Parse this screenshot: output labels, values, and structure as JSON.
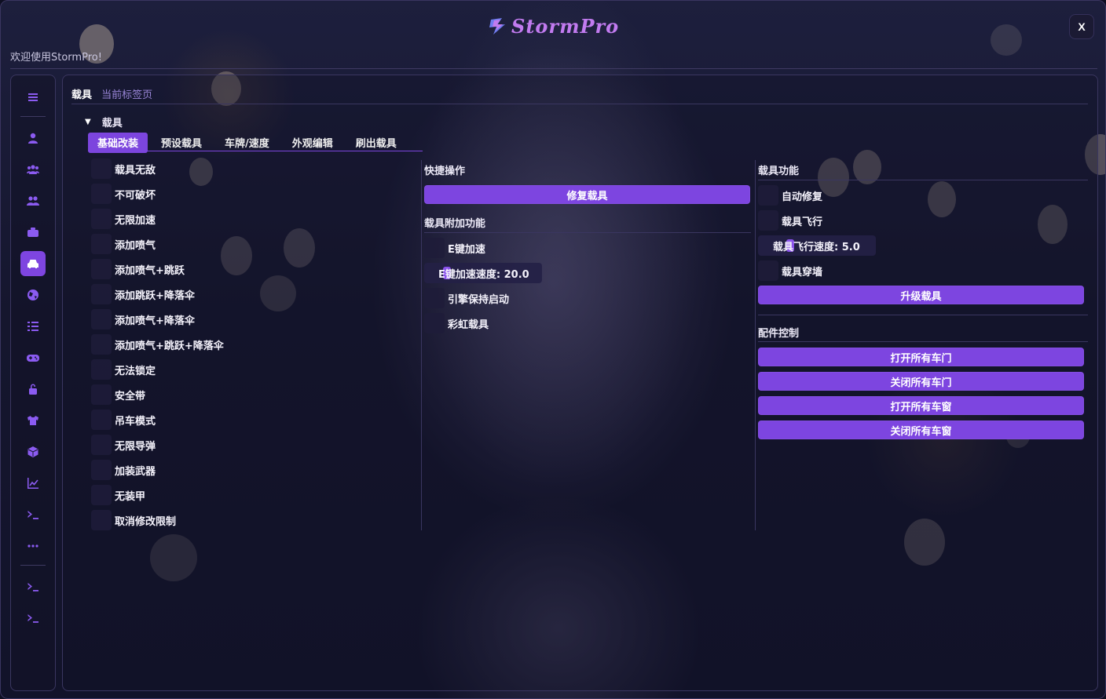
{
  "app": {
    "logo_text": "StormPro",
    "welcome": "欢迎使用StormPro!",
    "close_label": "X"
  },
  "colors": {
    "accent": "#7d45e0",
    "logo": "#c27bf0",
    "icon": "#8b5bf1"
  },
  "sidebar": {
    "items": [
      {
        "icon": "menu-icon"
      },
      {
        "icon": "user-icon"
      },
      {
        "icon": "users-icon"
      },
      {
        "icon": "user-group-icon"
      },
      {
        "icon": "briefcase-icon"
      },
      {
        "icon": "car-icon",
        "active": true
      },
      {
        "icon": "globe-icon"
      },
      {
        "icon": "list-icon"
      },
      {
        "icon": "gamepad-icon"
      },
      {
        "icon": "lock-icon"
      },
      {
        "icon": "shirt-icon"
      },
      {
        "icon": "cube-icon"
      },
      {
        "icon": "chart-icon"
      },
      {
        "icon": "terminal-icon"
      },
      {
        "icon": "more-icon"
      },
      {
        "icon": "terminal-icon"
      },
      {
        "icon": "terminal-icon"
      }
    ]
  },
  "breadcrumb": {
    "section": "载具",
    "current": "当前标签页"
  },
  "section": {
    "title": "载具"
  },
  "tabs": [
    {
      "label": "基础改装",
      "active": true
    },
    {
      "label": "预设载具"
    },
    {
      "label": "车牌/速度"
    },
    {
      "label": "外观编辑"
    },
    {
      "label": "刷出载具"
    }
  ],
  "left_options": [
    "载具无敌",
    "不可破坏",
    "无限加速",
    "添加喷气",
    "添加喷气+跳跃",
    "添加跳跃+降落伞",
    "添加喷气+降落伞",
    "添加喷气+跳跃+降落伞",
    "无法锁定",
    "安全带",
    "吊车模式",
    "无限导弹",
    "加装武器",
    "无装甲",
    "取消修改限制"
  ],
  "quick": {
    "title": "快捷操作",
    "repair_button": "修复载具"
  },
  "extras": {
    "title": "载具附加功能",
    "e_boost": "E键加速",
    "e_boost_speed": {
      "label": "E键加速速度: 20.0",
      "value": 20.0
    },
    "engine_keep": "引擎保持启动",
    "rainbow": "彩虹载具"
  },
  "vehicle_functions": {
    "title": "载具功能",
    "auto_repair": "自动修复",
    "fly": "载具飞行",
    "fly_speed": {
      "label": "载具飞行速度: 5.0",
      "value": 5.0
    },
    "no_clip": "载具穿墙",
    "upgrade_button": "升级载具"
  },
  "parts": {
    "title": "配件控制",
    "buttons": [
      "打开所有车门",
      "关闭所有车门",
      "打开所有车窗",
      "关闭所有车窗"
    ]
  }
}
